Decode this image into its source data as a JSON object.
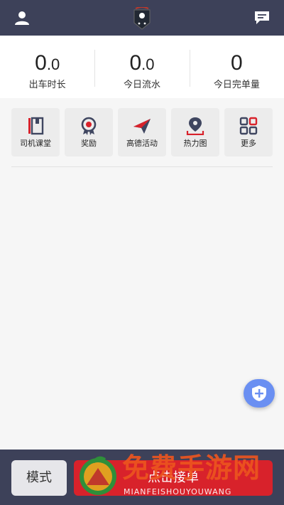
{
  "header": {
    "user_icon": "user-icon",
    "logo_icon": "shield-logo-icon",
    "message_icon": "message-icon"
  },
  "stats": [
    {
      "value_int": "0",
      "value_dec": ".0",
      "label": "出车时长"
    },
    {
      "value_int": "0",
      "value_dec": ".0",
      "label": "今日流水"
    },
    {
      "value_int": "0",
      "value_dec": "",
      "label": "今日完单量"
    }
  ],
  "tools": [
    {
      "label": "司机课堂",
      "icon": "notebook-icon"
    },
    {
      "label": "奖励",
      "icon": "award-medal-icon"
    },
    {
      "label": "高德活动",
      "icon": "paper-plane-icon"
    },
    {
      "label": "热力图",
      "icon": "location-pin-icon"
    },
    {
      "label": "更多",
      "icon": "grid-more-icon"
    }
  ],
  "fab": {
    "icon": "shield-plus-icon"
  },
  "bottom": {
    "mode_label": "模式",
    "accept_label": "点击接单"
  },
  "watermark": {
    "title": "免费手游网",
    "subtitle": "MIANFEISHOUYOUWANG"
  },
  "colors": {
    "header_bg": "#3d4159",
    "accent_red": "#d8222b",
    "fab_blue": "#6a8ff2",
    "icon_dark": "#3f4660"
  }
}
